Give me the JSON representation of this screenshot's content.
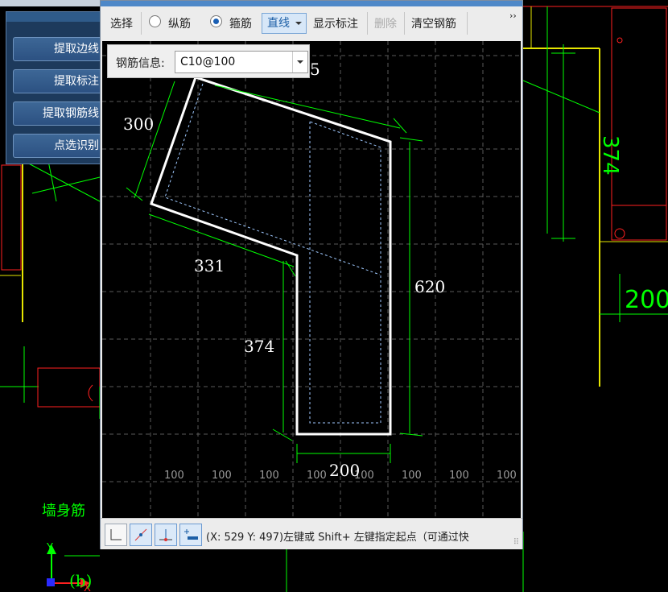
{
  "tool_panel": {
    "buttons": [
      "提取边线",
      "提取标注",
      "提取钢筋线",
      "点选识别"
    ]
  },
  "toolbar": {
    "select": "选择",
    "longitudinal": "纵筋",
    "stirrup": "箍筋",
    "stirrup_selected": true,
    "line_mode": "直线",
    "show_dims": "显示标注",
    "delete": "删除",
    "clear": "清空钢筋",
    "overflow": "››"
  },
  "rebar_info": {
    "label": "钢筋信息:",
    "value": "C10@100"
  },
  "shape_dims": {
    "top": "5",
    "left": "300",
    "mid": "331",
    "inner": "374",
    "right": "620",
    "bottom": "200",
    "grid_labels": [
      "100",
      "100",
      "100",
      "100",
      "100",
      "100",
      "100",
      "100"
    ]
  },
  "background_cad": {
    "right_dim_vertical": "374",
    "right_dim_horizontal": "200",
    "wall_label": "墙身筋"
  },
  "status": {
    "text": "(X: 529 Y: 497)左键或 Shift+ 左键指定起点（可通过快"
  },
  "colors": {
    "cad_green": "#00ff00",
    "cad_red": "#ff2020",
    "cad_yellow": "#e6e600",
    "accent": "#1d5fa6"
  }
}
